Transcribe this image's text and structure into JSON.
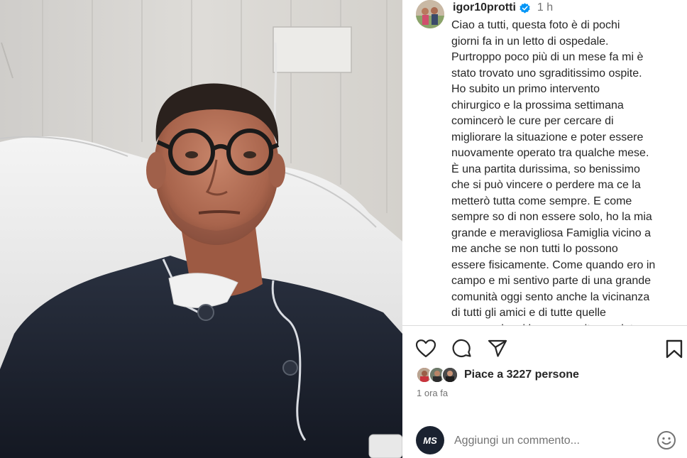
{
  "post": {
    "username": "igor10protti",
    "time_short": "1 h",
    "caption": "Ciao a tutti, questa foto è di pochi\ngiorni fa in un letto di ospedale.\nPurtroppo poco più di un mese fa mi è\nstato trovato uno sgraditissimo ospite.\nHo subito un primo intervento\nchirurgico e la prossima settimana\ncomincerò le cure per cercare di\nmigliorare la situazione e poter essere\nnuovamente operato tra qualche mese.\nÈ una partita durissima, so benissimo\nche si può vincere o perdere ma ce la\nmetterò tutta come sempre. E come\nsempre so di non essere solo, ho la mia\ngrande e meravigliosa Famiglia vicino a\nme anche se non tutti lo possono\nessere fisicamente. Come quando ero in\ncampo e mi sentivo parte di una grande\ncomunità oggi sento anche la vicinanza\ndi tutti gli amici e di tutte quelle\npersone che si hanno cercito e volute",
    "likes_text": "Piace a 3227 persone",
    "time_ago": "1 ora fa"
  },
  "comment": {
    "placeholder": "Aggiungi un commento...",
    "avatar_text": "MS"
  },
  "icons": {
    "like": "heart-icon",
    "comment": "speech-bubble-icon",
    "share": "paper-plane-icon",
    "save": "bookmark-icon",
    "emoji": "smiley-icon",
    "verified": "verified-badge-icon"
  },
  "colors": {
    "text": "#262626",
    "secondary": "#737373",
    "verified": "#0095f6",
    "divider": "#dbdbdb"
  }
}
